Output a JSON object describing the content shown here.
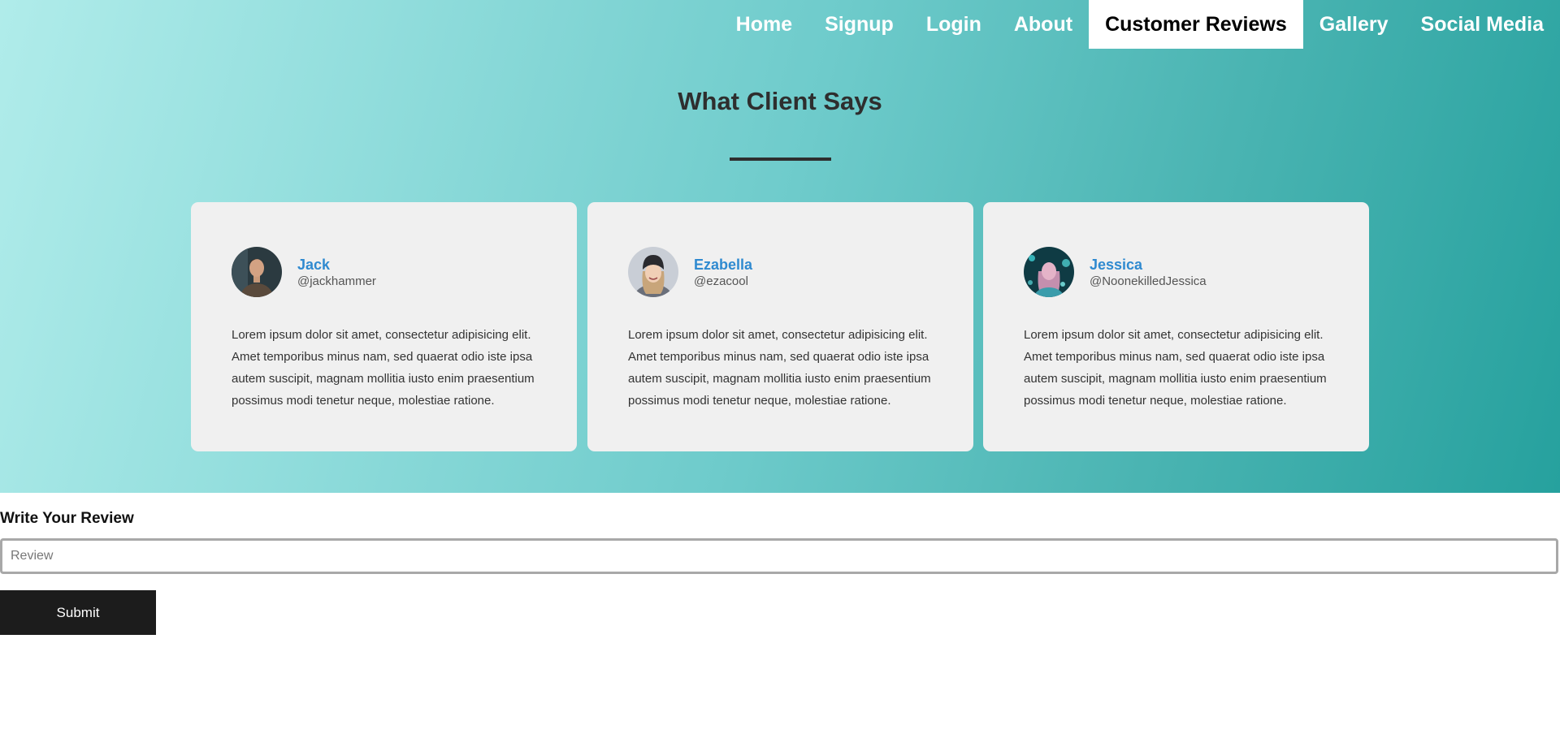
{
  "nav": {
    "items": [
      {
        "label": "Home",
        "active": false
      },
      {
        "label": "Signup",
        "active": false
      },
      {
        "label": "Login",
        "active": false
      },
      {
        "label": "About",
        "active": false
      },
      {
        "label": "Customer Reviews",
        "active": true
      },
      {
        "label": "Gallery",
        "active": false
      },
      {
        "label": "Social Media",
        "active": false
      }
    ]
  },
  "testimonials": {
    "title": "What Client Says",
    "cards": [
      {
        "name": "Jack",
        "handle": "@jackhammer",
        "text": "Lorem ipsum dolor sit amet, consectetur adipisicing elit. Amet temporibus minus nam, sed quaerat odio iste ipsa autem suscipit, magnam mollitia iusto enim praesentium possimus modi tenetur neque, molestiae ratione."
      },
      {
        "name": "Ezabella",
        "handle": "@ezacool",
        "text": "Lorem ipsum dolor sit amet, consectetur adipisicing elit. Amet temporibus minus nam, sed quaerat odio iste ipsa autem suscipit, magnam mollitia iusto enim praesentium possimus modi tenetur neque, molestiae ratione."
      },
      {
        "name": "Jessica",
        "handle": "@NoonekilledJessica",
        "text": "Lorem ipsum dolor sit amet, consectetur adipisicing elit. Amet temporibus minus nam, sed quaerat odio iste ipsa autem suscipit, magnam mollitia iusto enim praesentium possimus modi tenetur neque, molestiae ratione."
      }
    ]
  },
  "review_form": {
    "label": "Write Your Review",
    "placeholder": "Review",
    "value": "",
    "submit_label": "Submit"
  },
  "colors": {
    "accent_name": "#2f8ad0",
    "gradient_start": "#b0ecea",
    "gradient_end": "#26a19e",
    "card_bg": "#f0f0f0",
    "button_bg": "#1c1c1c"
  }
}
